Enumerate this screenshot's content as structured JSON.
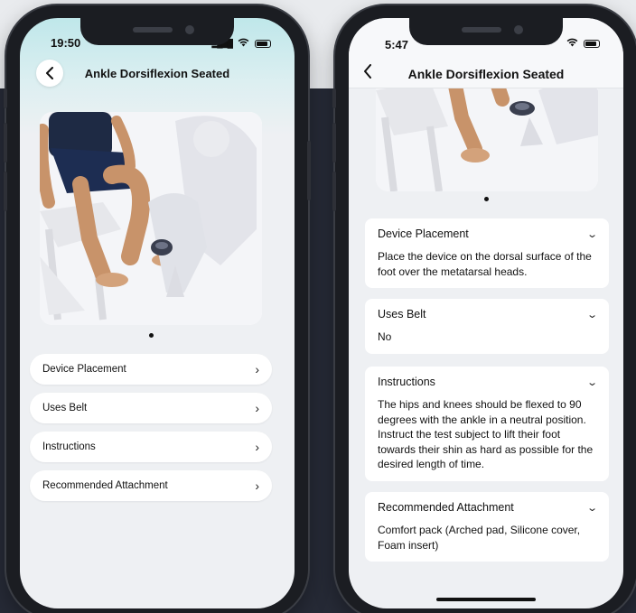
{
  "left_phone": {
    "time": "19:50",
    "title": "Ankle Dorsiflexion Seated",
    "rows": [
      {
        "label": "Device Placement"
      },
      {
        "label": "Uses Belt"
      },
      {
        "label": "Instructions"
      },
      {
        "label": "Recommended Attachment"
      }
    ]
  },
  "right_phone": {
    "time": "5:47",
    "title": "Ankle Dorsiflexion Seated",
    "sections": [
      {
        "title": "Device Placement",
        "body": "Place the device on the dorsal surface of the foot over the metatarsal heads."
      },
      {
        "title": "Uses Belt",
        "body": "No"
      },
      {
        "title": "Instructions",
        "body": "The hips and knees should be flexed to 90 degrees with the ankle in a neutral position. Instruct the test subject to lift their foot towards their shin as hard as possible for the desired length of time."
      },
      {
        "title": "Recommended Attachment",
        "body": "Comfort pack (Arched pad, Silicone cover, Foam insert)"
      }
    ]
  },
  "icons": {
    "back": "chevron-left-icon",
    "row_chevron": "chevron-right-icon",
    "section_chevron": "chevron-down-icon"
  },
  "colors": {
    "backdrop": "#262a36",
    "page_bg": "#e9ebee",
    "screen_bg": "#eef0f3",
    "header_gradient_top": "#bfe7ea",
    "card_bg": "#ffffff"
  }
}
